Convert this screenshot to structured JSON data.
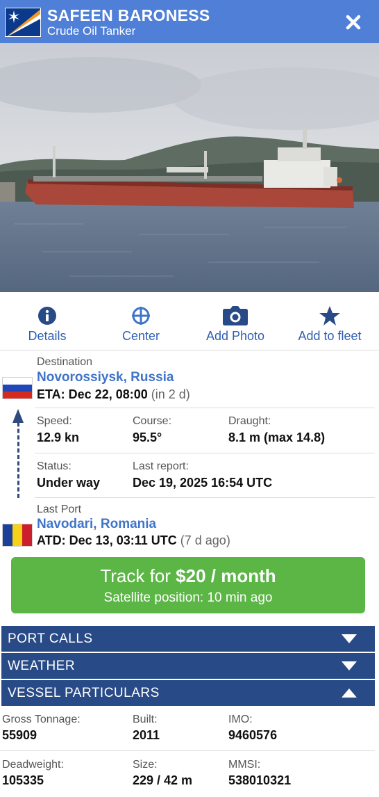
{
  "header": {
    "title": "SAFEEN BARONESS",
    "subtitle": "Crude Oil Tanker",
    "flag_icon": "marshall-islands-flag-icon",
    "close_icon": "close-icon",
    "color": "#4f7fd6"
  },
  "actions": [
    {
      "label": "Details",
      "icon": "info-icon"
    },
    {
      "label": "Center",
      "icon": "crosshair-icon"
    },
    {
      "label": "Add Photo",
      "icon": "camera-icon"
    },
    {
      "label": "Add to fleet",
      "icon": "star-icon"
    }
  ],
  "voyage": {
    "destination_label": "Destination",
    "destination": "Novorossiysk, Russia",
    "eta": "ETA: Dec 22, 08:00",
    "eta_relative": "(in 2 d)",
    "speed_label": "Speed:",
    "speed": "12.9 kn",
    "course_label": "Course:",
    "course": "95.5°",
    "draught_label": "Draught:",
    "draught": "8.1 m (max 14.8)",
    "status_label": "Status:",
    "status": "Under way",
    "last_report_label": "Last report:",
    "last_report": "Dec 19, 2025 16:54 UTC",
    "last_port_label": "Last Port",
    "last_port": "Navodari, Romania",
    "atd": "ATD: Dec 13, 03:11 UTC",
    "atd_relative": "(7 d ago)"
  },
  "track": {
    "prefix": "Track for ",
    "price": "$20 / month",
    "subtitle": "Satellite position: 10 min ago",
    "color": "#5cb646"
  },
  "sections": [
    {
      "title": "PORT CALLS",
      "expanded": false
    },
    {
      "title": "WEATHER",
      "expanded": false
    },
    {
      "title": "VESSEL PARTICULARS",
      "expanded": true
    }
  ],
  "particulars": {
    "gross_tonnage_label": "Gross Tonnage:",
    "gross_tonnage": "55909",
    "built_label": "Built:",
    "built": "2011",
    "imo_label": "IMO:",
    "imo": "9460576",
    "deadweight_label": "Deadweight:",
    "deadweight": "105335",
    "size_label": "Size:",
    "size": "229 / 42 m",
    "mmsi_label": "MMSI:",
    "mmsi": "538010321"
  }
}
